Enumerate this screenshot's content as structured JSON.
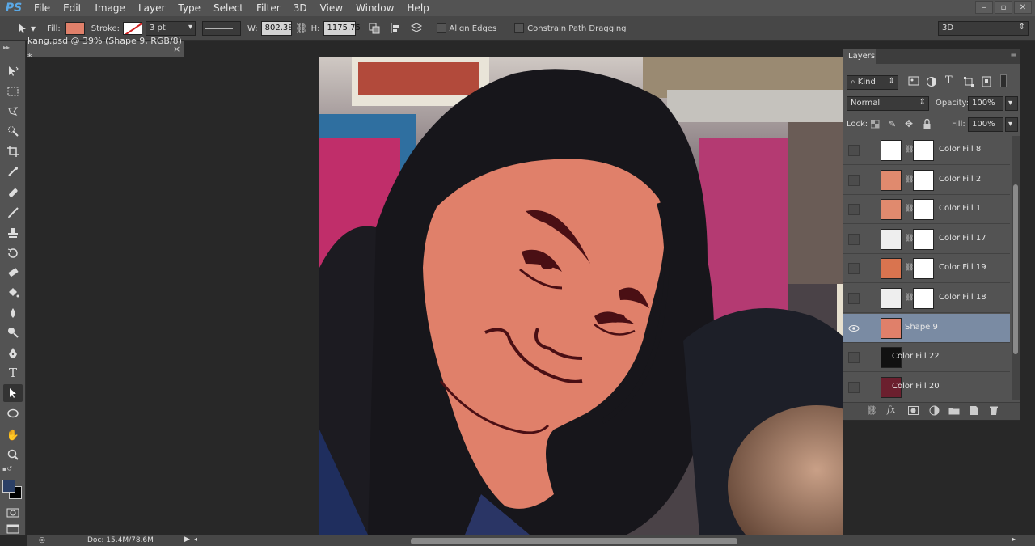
{
  "app": {
    "logo": "PS"
  },
  "menu": [
    "File",
    "Edit",
    "Image",
    "Layer",
    "Type",
    "Select",
    "Filter",
    "3D",
    "View",
    "Window",
    "Help"
  ],
  "window_buttons": [
    "–",
    "▫",
    "✕"
  ],
  "options": {
    "fill_label": "Fill:",
    "fill_color": "#e0806a",
    "stroke_label": "Stroke:",
    "stroke_width": "3 pt",
    "w_label": "W:",
    "w_value": "802.38 |",
    "h_label": "H:",
    "h_value": "1175.75",
    "align_edges": "Align Edges",
    "constrain": "Constrain Path Dragging",
    "workspace": "3D"
  },
  "document": {
    "tab_title": "kang.psd @ 39% (Shape 9, RGB/8) *",
    "close": "×"
  },
  "status": {
    "doc": "Doc: 15.4M/78.6M"
  },
  "layers_panel": {
    "title": "Layers",
    "filter_kind": "Kind",
    "blend_mode": "Normal",
    "opacity_label": "Opacity:",
    "opacity_value": "100%",
    "lock_label": "Lock:",
    "fill_label": "Fill:",
    "fill_value": "100%",
    "layers": [
      {
        "name": "Color Fill 8",
        "visible": false,
        "selected": false,
        "thumb": "#ffffff"
      },
      {
        "name": "Color Fill 2",
        "visible": false,
        "selected": false,
        "thumb": "#e08a6e"
      },
      {
        "name": "Color Fill 1",
        "visible": false,
        "selected": false,
        "thumb": "#e08a6e"
      },
      {
        "name": "Color Fill 17",
        "visible": false,
        "selected": false,
        "thumb": "#eeeeee"
      },
      {
        "name": "Color Fill 19",
        "visible": false,
        "selected": false,
        "thumb": "#d9744f"
      },
      {
        "name": "Color Fill 18",
        "visible": false,
        "selected": false,
        "thumb": "#eeeeee"
      },
      {
        "name": "Shape 9",
        "visible": true,
        "selected": true,
        "thumb": "#e0806a"
      },
      {
        "name": "Color Fill 22",
        "visible": false,
        "selected": false,
        "thumb": "#111111"
      },
      {
        "name": "Color Fill 20",
        "visible": false,
        "selected": false,
        "thumb": "#6b1f2e"
      }
    ]
  },
  "colors": {
    "foreground": "#2b3f66",
    "background": "#000000"
  }
}
